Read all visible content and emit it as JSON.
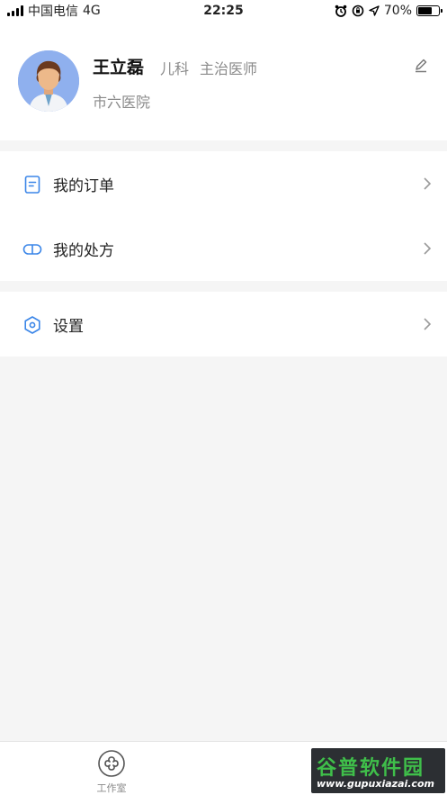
{
  "status_bar": {
    "carrier": "中国电信",
    "network": "4G",
    "time": "22:25",
    "battery": "70%",
    "battery_level": 0.7
  },
  "profile": {
    "name": "王立磊",
    "department": "儿科",
    "title": "主治医师",
    "hospital": "市六医院",
    "avatar_icon": "doctor-avatar",
    "edit_icon": "pencil-icon"
  },
  "menu": {
    "orders": {
      "label": "我的订单",
      "icon": "document-icon"
    },
    "prescriptions": {
      "label": "我的处方",
      "icon": "pill-icon"
    },
    "settings": {
      "label": "设置",
      "icon": "hexagon-gear-icon"
    }
  },
  "tabbar": {
    "workroom": {
      "label": "工作室",
      "icon": "clover-icon"
    }
  },
  "watermark": {
    "title": "谷普软件园",
    "url": "www.gupuxiazai.com"
  },
  "colors": {
    "accent": "#3b86e8",
    "background": "#f5f5f5",
    "muted_text": "#8a8a8a"
  }
}
